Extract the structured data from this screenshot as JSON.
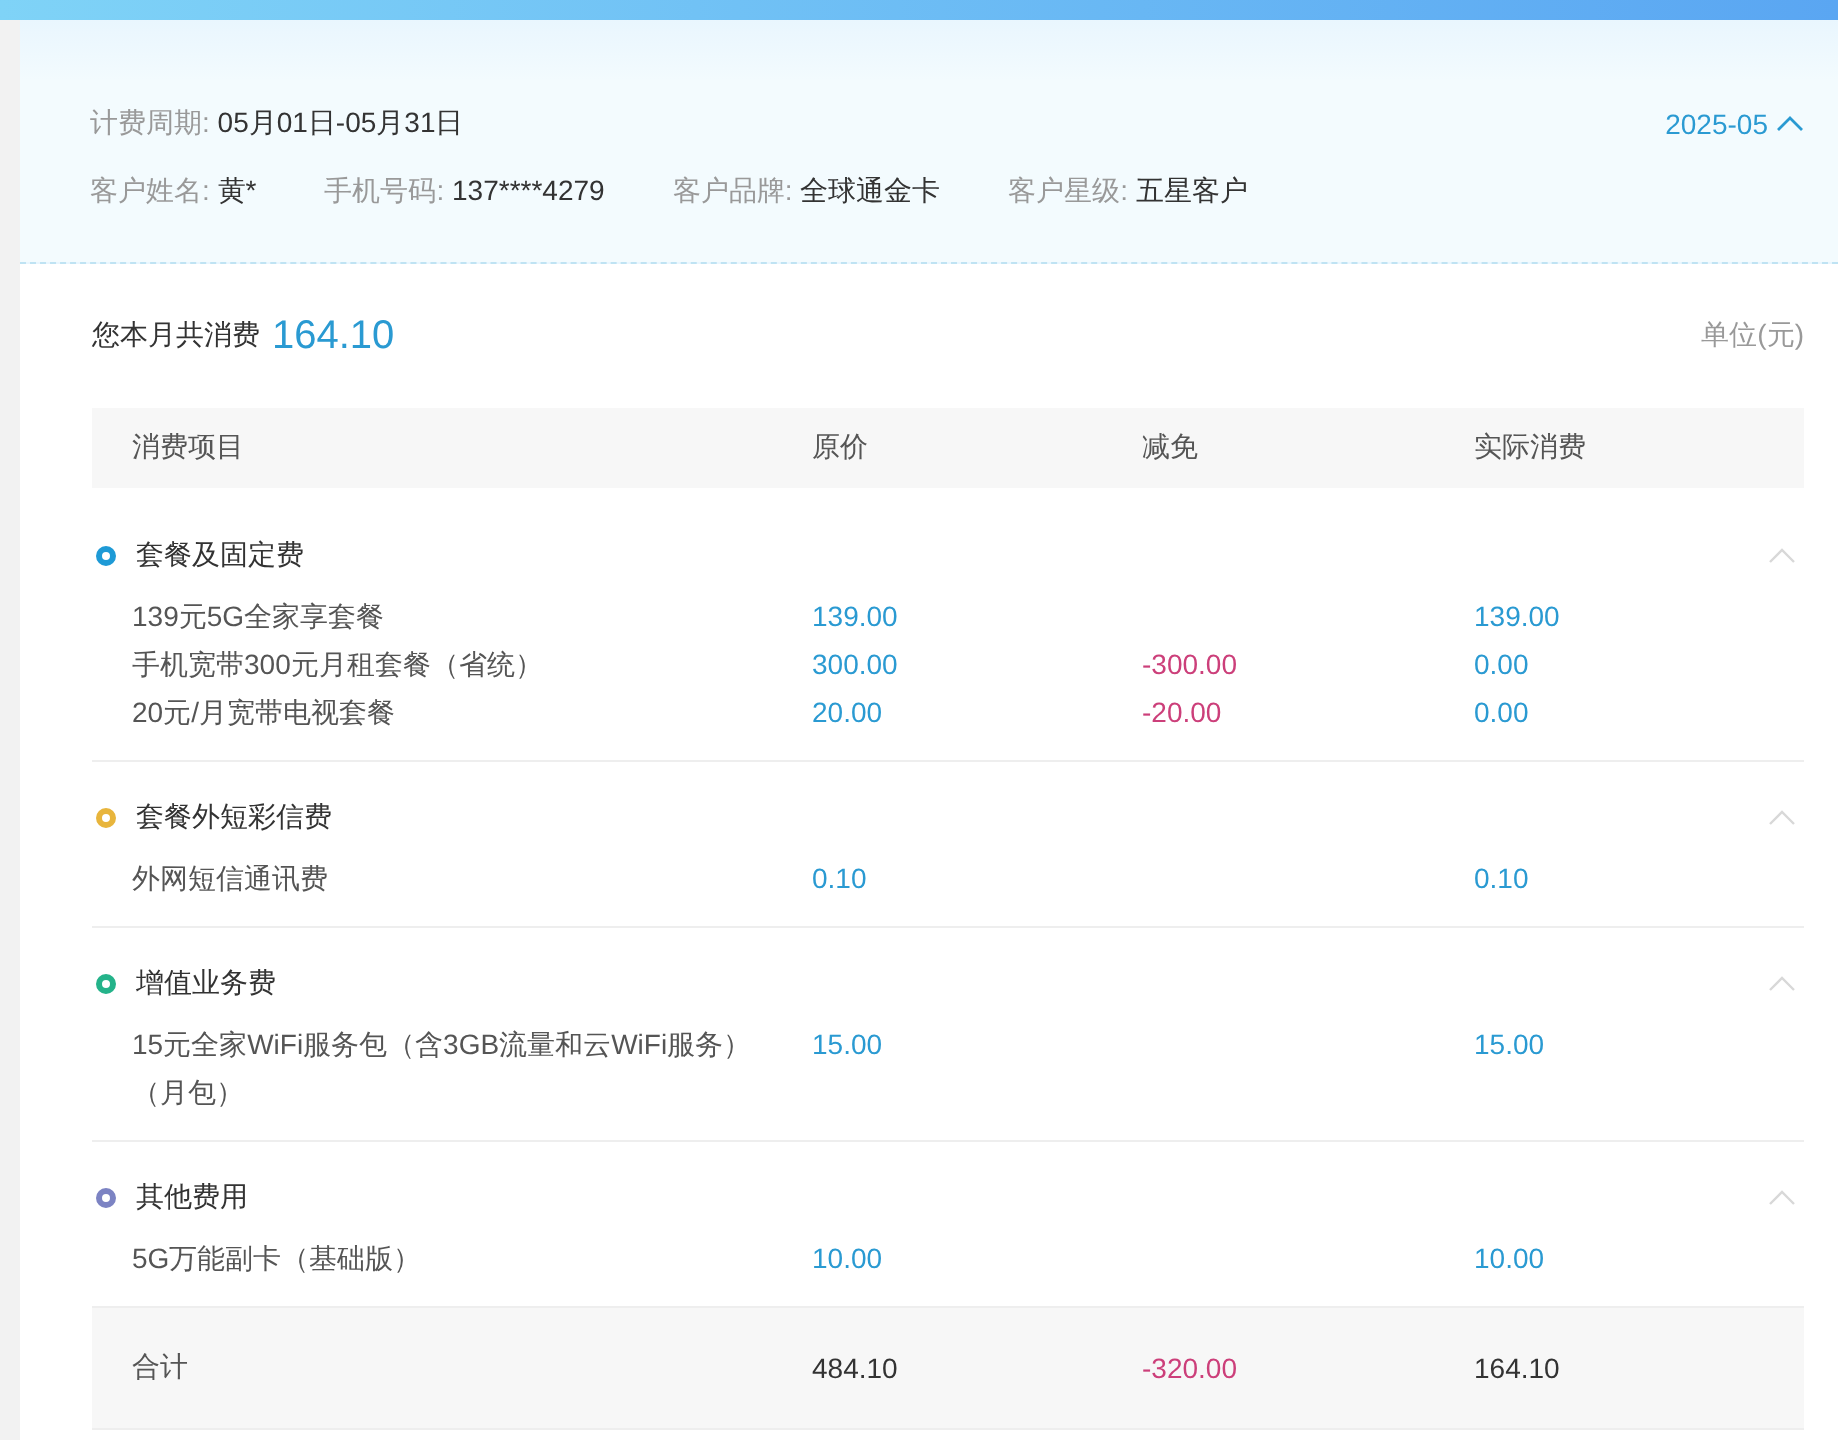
{
  "header": {
    "period": {
      "label": "计费周期:",
      "value": "05月01日-05月31日"
    },
    "month_picker": {
      "value": "2025-05",
      "expanded": true
    },
    "fields": [
      {
        "label": "客户姓名:",
        "value": "黄*"
      },
      {
        "label": "手机号码:",
        "value": "137****4279"
      },
      {
        "label": "客户品牌:",
        "value": "全球通金卡"
      },
      {
        "label": "客户星级:",
        "value": "五星客户"
      }
    ]
  },
  "summary": {
    "label": "您本月共消费",
    "amount": "164.10",
    "unit": "单位(元)"
  },
  "table": {
    "columns": [
      "消费项目",
      "原价",
      "减免",
      "实际消费"
    ],
    "groups": [
      {
        "title": "套餐及固定费",
        "color": "#1e9ad6",
        "expanded": true,
        "rows": [
          {
            "item": "139元5G全家享套餐",
            "original": "139.00",
            "discount": "",
            "actual": "139.00"
          },
          {
            "item": "手机宽带300元月租套餐（省统）",
            "original": "300.00",
            "discount": "-300.00",
            "actual": "0.00"
          },
          {
            "item": "20元/月宽带电视套餐",
            "original": "20.00",
            "discount": "-20.00",
            "actual": "0.00"
          }
        ]
      },
      {
        "title": "套餐外短彩信费",
        "color": "#e8b53c",
        "expanded": true,
        "rows": [
          {
            "item": "外网短信通讯费",
            "original": "0.10",
            "discount": "",
            "actual": "0.10"
          }
        ]
      },
      {
        "title": "增值业务费",
        "color": "#24b38a",
        "expanded": true,
        "rows": [
          {
            "item": "15元全家WiFi服务包（含3GB流量和云WiFi服务）（月包）",
            "original": "15.00",
            "discount": "",
            "actual": "15.00"
          }
        ]
      },
      {
        "title": "其他费用",
        "color": "#7c83c3",
        "expanded": true,
        "rows": [
          {
            "item": "5G万能副卡（基础版）",
            "original": "10.00",
            "discount": "",
            "actual": "10.00"
          }
        ]
      }
    ],
    "total": {
      "label": "合计",
      "original": "484.10",
      "discount": "-320.00",
      "actual": "164.10"
    }
  }
}
